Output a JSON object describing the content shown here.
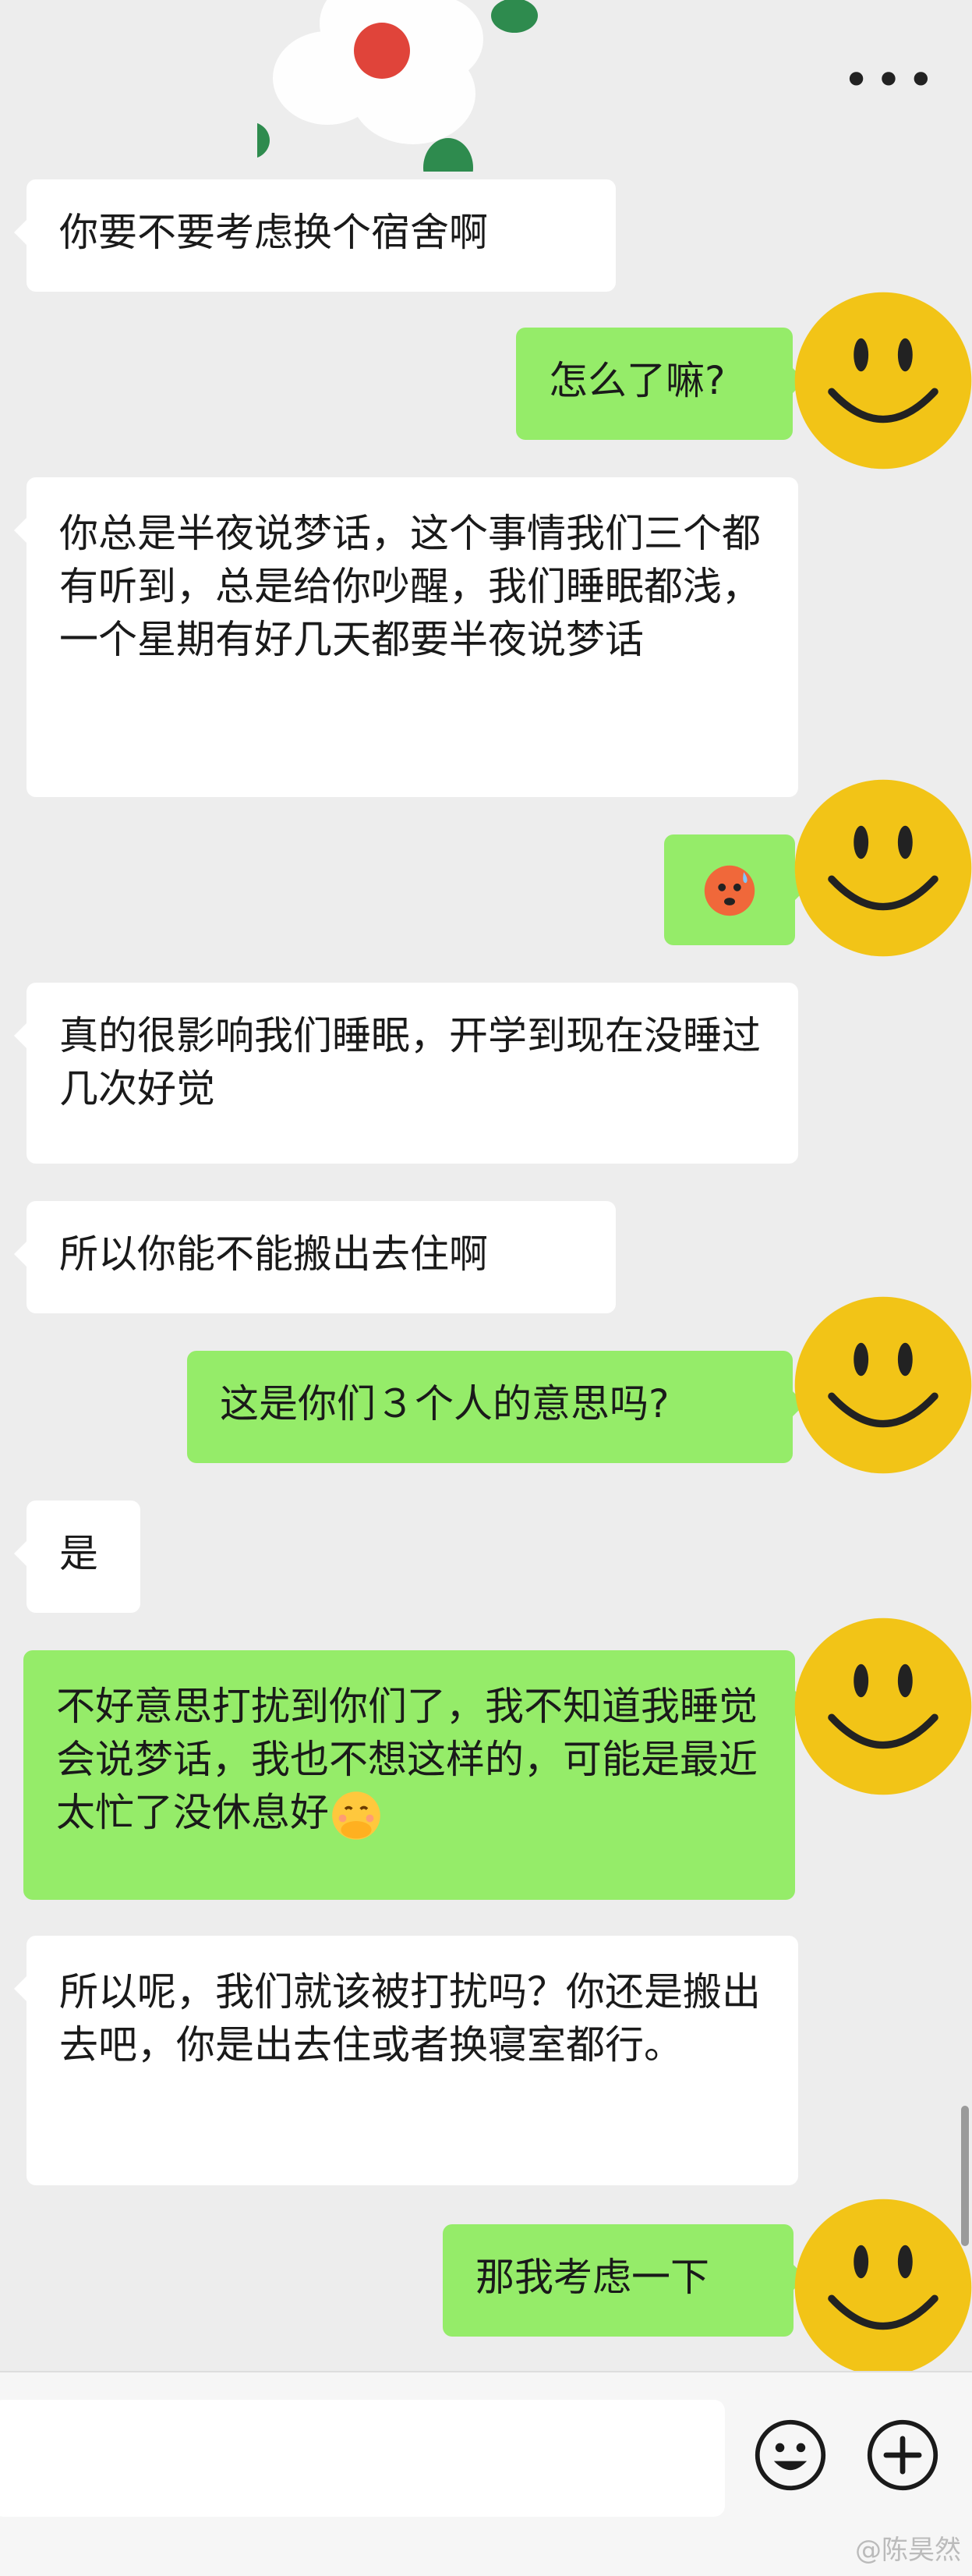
{
  "header": {
    "more_icon": "more-horizontal-icon"
  },
  "conversation": {
    "messages": [
      {
        "side": "received",
        "text": "你要不要考虑换个宿舍啊"
      },
      {
        "side": "sent",
        "text": "怎么了嘛?"
      },
      {
        "side": "received",
        "text": "你总是半夜说梦话，这个事情我们三个都有听到，总是给你吵醒，我们睡眠都浅，一个星期有好几天都要半夜说梦话"
      },
      {
        "side": "sent",
        "emoji": "anxious-sweat-face-emoji"
      },
      {
        "side": "received",
        "text": "真的很影响我们睡眠，开学到现在没睡过几次好觉"
      },
      {
        "side": "received",
        "text": "所以你能不能搬出去住啊"
      },
      {
        "side": "sent",
        "text": "这是你们３个人的意思吗?"
      },
      {
        "side": "received",
        "text": "是"
      },
      {
        "side": "sent",
        "text": "不好意思打扰到你们了，我不知道我睡觉会说梦话，我也不想这样的，可能是最近太忙了没休息好",
        "trailing_emoji": "hand-over-mouth-emoji"
      },
      {
        "side": "received",
        "text": "所以呢，我们就该被打扰吗？你还是搬出去吧，你是出去住或者换寝室都行。"
      },
      {
        "side": "sent",
        "text": "那我考虑一下"
      }
    ]
  },
  "input_bar": {
    "emoji_icon": "smiley-icon",
    "add_icon": "plus-circle-icon"
  },
  "watermark": {
    "text": "@陈昊然"
  },
  "colors": {
    "background": "#ededed",
    "sent_bubble": "#95ec69",
    "received_bubble": "#ffffff",
    "avatar": "#f2c417"
  }
}
